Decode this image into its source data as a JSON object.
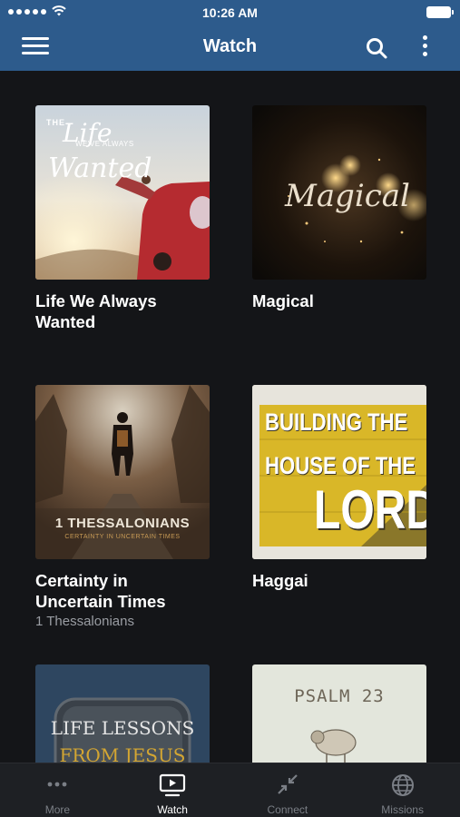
{
  "status_bar": {
    "time": "10:26 AM"
  },
  "nav": {
    "title": "Watch"
  },
  "items": [
    {
      "title": "Life We Always Wanted",
      "subtitle": "",
      "art": {
        "line1": "THE",
        "line2": "Life",
        "line3": "WE'VE ALWAYS",
        "line4": "Wanted"
      }
    },
    {
      "title": "Magical",
      "subtitle": "",
      "art": {
        "line1": "Magical"
      }
    },
    {
      "title": "Certainty in Uncertain Times",
      "subtitle": "1 Thessalonians",
      "art": {
        "line1": "1 THESSALONIANS",
        "line2": "CERTAINTY IN UNCERTAIN TIMES"
      }
    },
    {
      "title": "Haggai",
      "subtitle": "",
      "art": {
        "line1": "BUILDING THE",
        "line2": "HOUSE OF THE",
        "line3": "LORD"
      }
    },
    {
      "title": "",
      "subtitle": "",
      "art": {
        "line1": "LIFE LESSONS",
        "line2": "FROM JESUS"
      }
    },
    {
      "title": "",
      "subtitle": "",
      "art": {
        "line1": "PSALM 23"
      }
    }
  ],
  "tabs": [
    {
      "label": "More",
      "icon": "more-dots-icon",
      "active": false
    },
    {
      "label": "Watch",
      "icon": "tv-play-icon",
      "active": true
    },
    {
      "label": "Connect",
      "icon": "connect-arrows-icon",
      "active": false
    },
    {
      "label": "Missions",
      "icon": "globe-icon",
      "active": false
    }
  ],
  "colors": {
    "nav_bar": "#2d5b8c",
    "background": "#141518",
    "tab_bar": "#1e2024"
  }
}
